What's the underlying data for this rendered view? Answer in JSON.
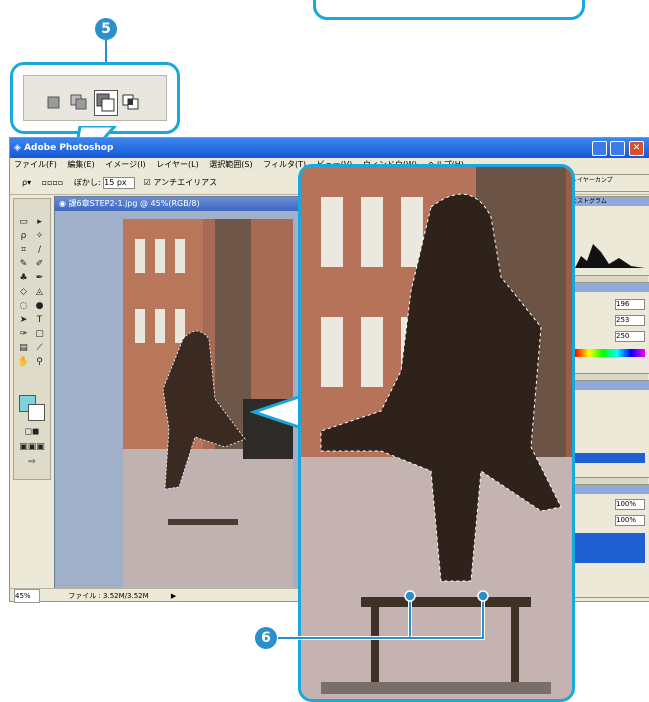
{
  "callouts": {
    "five": "5",
    "six": "6"
  },
  "window": {
    "title": "Adobe Photoshop",
    "menu": [
      "ファイル(F)",
      "編集(E)",
      "イメージ(I)",
      "レイヤー(L)",
      "選択範囲(S)",
      "フィルタ(T)",
      "ビュー(V)",
      "ウィンドウ(W)",
      "ヘルプ(H)"
    ]
  },
  "options_bar": {
    "feather_label": "ぼかし:",
    "feather_value": "15 px",
    "antialias_label": "アンチエイリアス"
  },
  "document": {
    "title": "課6章STEP2-1.jpg @ 45%(RGB/8)"
  },
  "status_bar": {
    "zoom": "45%",
    "file_info": "ファイル : 3.52M/3.52M"
  },
  "panels": {
    "histogram_tab": "ヒストグラム",
    "layer_comps_tab": "レイヤーカンプ",
    "values": [
      "196",
      "253",
      "250"
    ],
    "opacity": "100%",
    "fill": "100%"
  },
  "colors": {
    "accent": "#1aa7de",
    "badge": "#2a8fcb",
    "titlebar": "#2260de"
  }
}
